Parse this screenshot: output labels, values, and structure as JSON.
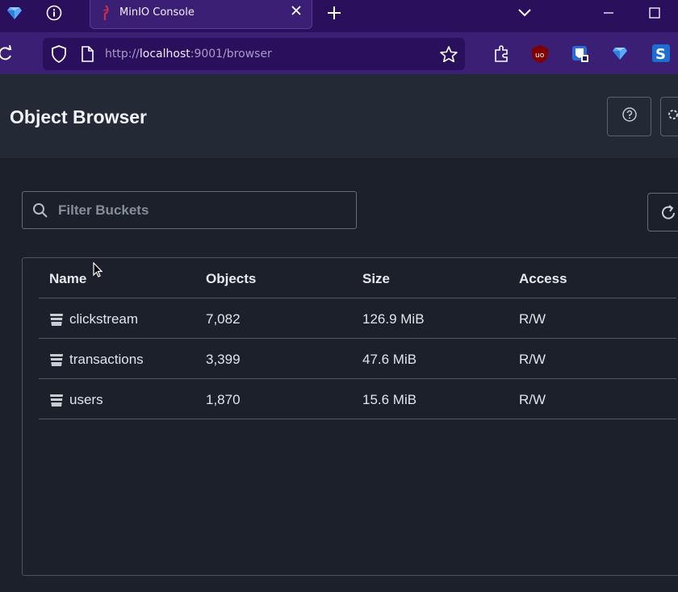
{
  "browser": {
    "tab_title": "MinIO Console",
    "url_prefix": "http://",
    "url_host": "localhost",
    "url_rest": ":9001/browser"
  },
  "header": {
    "title": "Object Browser"
  },
  "filter": {
    "placeholder": "Filter Buckets"
  },
  "table": {
    "headers": [
      "Name",
      "Objects",
      "Size",
      "Access"
    ],
    "rows": [
      {
        "name": "clickstream",
        "objects": "7,082",
        "size": "126.9 MiB",
        "access": "R/W"
      },
      {
        "name": "transactions",
        "objects": "3,399",
        "size": "47.6 MiB",
        "access": "R/W"
      },
      {
        "name": "users",
        "objects": "1,870",
        "size": "15.6 MiB",
        "access": "R/W"
      }
    ]
  },
  "colors": {
    "browser_frame": "#2a0f5c",
    "toolbar": "#3b1f74",
    "page_bg": "#1b202a",
    "header_bg": "#232935"
  }
}
